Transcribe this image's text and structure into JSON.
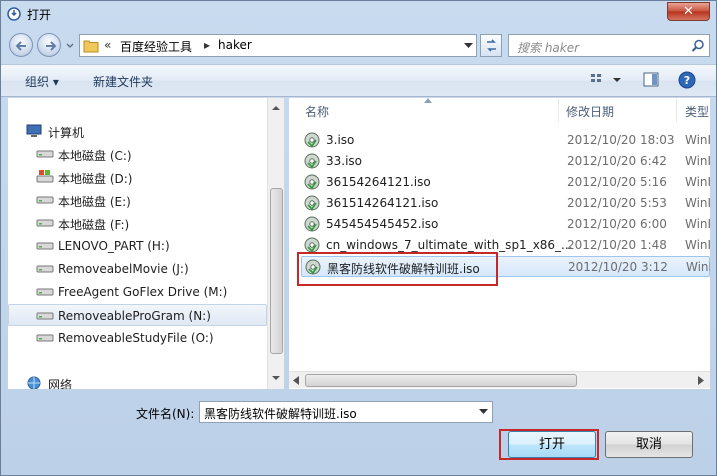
{
  "window": {
    "title": "打开",
    "close_label": "✕"
  },
  "address": {
    "crumb_sep": "«",
    "crumbs": [
      "百度经验工具",
      "haker"
    ],
    "search_placeholder": "搜索 haker"
  },
  "toolbar": {
    "organize": "组织 ▾",
    "new_folder": "新建文件夹"
  },
  "nav": {
    "items": [
      {
        "label": "计算机",
        "icon": "computer-icon"
      },
      {
        "label": "本地磁盘 (C:)",
        "icon": "drive-icon"
      },
      {
        "label": "本地磁盘 (D:)",
        "icon": "system-drive-icon"
      },
      {
        "label": "本地磁盘 (E:)",
        "icon": "drive-icon"
      },
      {
        "label": "本地磁盘 (F:)",
        "icon": "drive-icon"
      },
      {
        "label": "LENOVO_PART (H:)",
        "icon": "drive-icon"
      },
      {
        "label": "RemoveabelMovie (J:)",
        "icon": "drive-icon"
      },
      {
        "label": "FreeAgent GoFlex Drive (M:)",
        "icon": "drive-icon"
      },
      {
        "label": "RemoveableProGram (N:)",
        "icon": "drive-icon"
      },
      {
        "label": "RemoveableStudyFile (O:)",
        "icon": "drive-icon"
      },
      {
        "label": "网络",
        "icon": "network-icon"
      }
    ]
  },
  "files": {
    "columns": {
      "name": "名称",
      "date": "修改日期",
      "type": "类型"
    },
    "rows": [
      {
        "name": "3.iso",
        "date": "2012/10/20 18:03",
        "type": "WinI"
      },
      {
        "name": "33.iso",
        "date": "2012/10/20 6:42",
        "type": "WinI"
      },
      {
        "name": "36154264121.iso",
        "date": "2012/10/20 5:16",
        "type": "WinI"
      },
      {
        "name": "361514264121.iso",
        "date": "2012/10/20 5:53",
        "type": "WinI"
      },
      {
        "name": "545454545452.iso",
        "date": "2012/10/20 6:00",
        "type": "WinI"
      },
      {
        "name": "cn_windows_7_ultimate_with_sp1_x86_...",
        "date": "2012/10/20 1:48",
        "type": "WinI"
      },
      {
        "name": "黑客防线软件破解特训班.iso",
        "date": "2012/10/20 3:12",
        "type": "WinI"
      }
    ]
  },
  "filename": {
    "label": "文件名(N):",
    "value": "黑客防线软件破解特训班.iso"
  },
  "buttons": {
    "open": "打开",
    "cancel": "取消"
  },
  "colors": {
    "highlight": "#c62828",
    "selection": "#d6e8fb"
  }
}
